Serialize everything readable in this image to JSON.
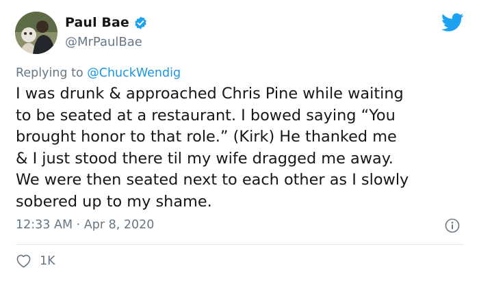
{
  "author": {
    "display_name": "Paul Bae",
    "handle": "@MrPaulBae"
  },
  "reply": {
    "prefix": "Replying to ",
    "mention": "@ChuckWendig"
  },
  "tweet": {
    "lines": [
      "I was drunk & approached Chris Pine while waiting",
      "to be seated at a restaurant. I bowed saying “You",
      "brought honor to that role.” (Kirk) He thanked me",
      "& I just stood there til my wife dragged me away.",
      "We were then seated next to each other as I slowly",
      "sobered up to my shame."
    ],
    "timestamp": "12:33 AM · Apr 8, 2020"
  },
  "engagement": {
    "likes": "1K"
  },
  "icons": {
    "verified": "verified-badge-icon",
    "brand": "twitter-bird-icon",
    "info": "info-icon",
    "like": "heart-icon"
  },
  "colors": {
    "accent": "#1da1f2",
    "link": "#1b95e0",
    "secondary_text": "#657786",
    "primary_text": "#14171a",
    "divider": "#e1e8ed"
  }
}
